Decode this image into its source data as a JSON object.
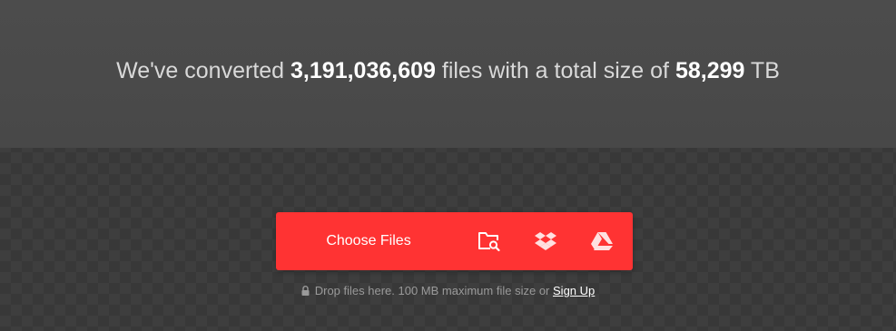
{
  "stats": {
    "prefix": "We've converted",
    "files_count": "3,191,036,609",
    "middle": "files with a total size of",
    "total_size": "58,299",
    "unit": "TB"
  },
  "upload": {
    "choose_files_label": "Choose Files",
    "sources": [
      {
        "icon": "folder-search-icon"
      },
      {
        "icon": "dropbox-icon"
      },
      {
        "icon": "google-drive-icon"
      }
    ],
    "colors": {
      "accent": "#ff3333"
    }
  },
  "hint": {
    "text": "Drop files here. 100 MB maximum file size or",
    "signup_label": "Sign Up"
  }
}
